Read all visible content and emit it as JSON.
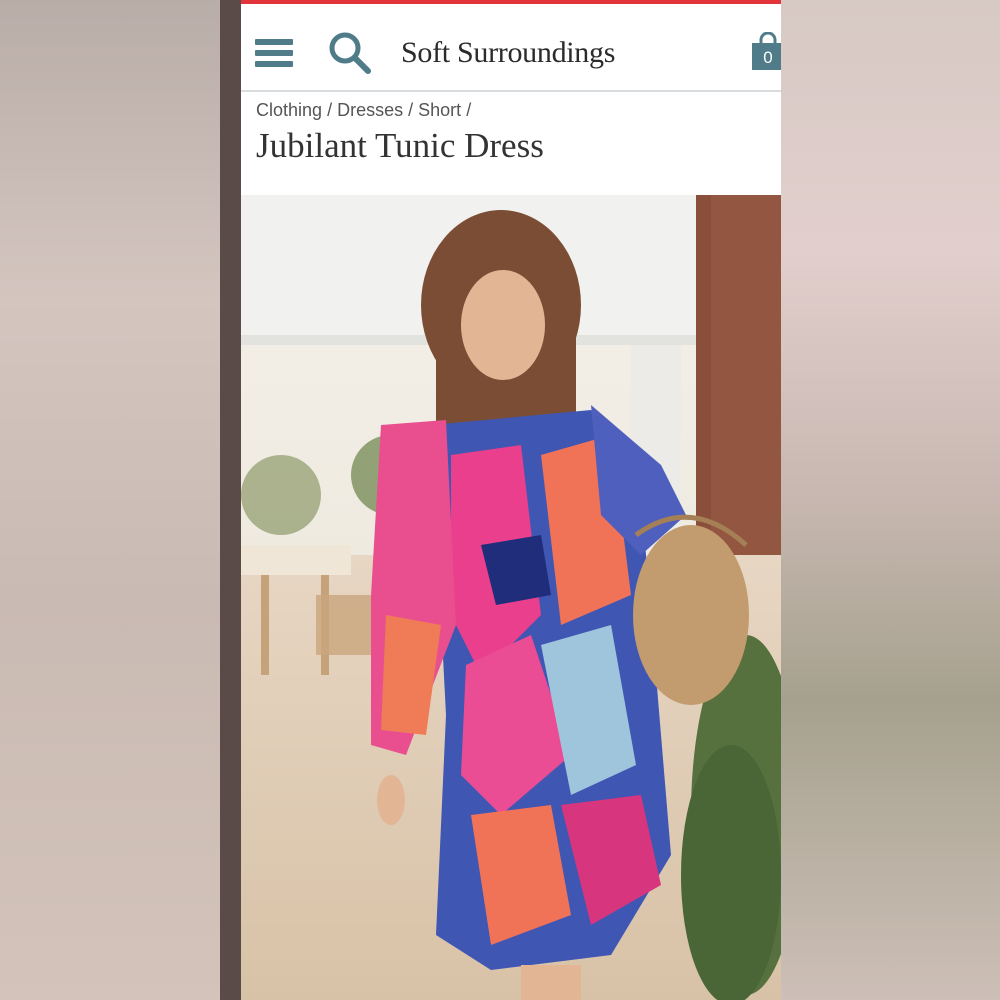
{
  "header": {
    "brand": "Soft Surroundings",
    "cart_count": "0",
    "icons": [
      "menu-icon",
      "search-icon",
      "shopping-bag-icon"
    ]
  },
  "breadcrumb": {
    "items": [
      "Clothing",
      "Dresses",
      "Short"
    ],
    "separator": "/"
  },
  "product": {
    "title": "Jubilant Tunic Dress"
  },
  "colors": {
    "accent_top_bar": "#e2343a",
    "icon_teal": "#4f7c88",
    "text_dark": "#333333"
  }
}
